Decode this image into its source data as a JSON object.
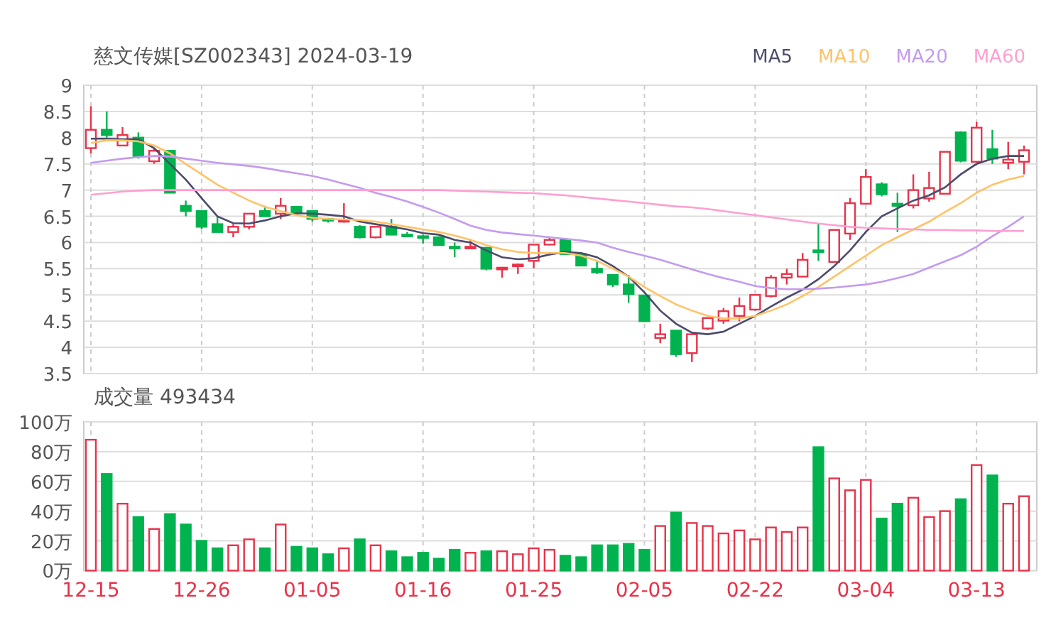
{
  "header": {
    "title": "慈文传媒[SZ002343] 2024-03-19"
  },
  "price_chart": {
    "chart_data": {
      "type": "candlestick",
      "ylim": [
        3.5,
        9
      ],
      "yticks": [
        3.5,
        4,
        4.5,
        5,
        5.5,
        6,
        6.5,
        7,
        7.5,
        8,
        8.5,
        9
      ],
      "grid": true,
      "series": [
        {
          "name": "MA5",
          "type": "line",
          "color": "#4b4b6b",
          "values": [
            7.98,
            7.98,
            7.97,
            7.97,
            7.8,
            7.5,
            7.2,
            6.85,
            6.5,
            6.37,
            6.36,
            6.42,
            6.5,
            6.56,
            6.55,
            6.53,
            6.5,
            6.4,
            6.35,
            6.3,
            6.25,
            6.18,
            6.15,
            6.05,
            6.0,
            5.85,
            5.72,
            5.68,
            5.7,
            5.77,
            5.82,
            5.8,
            5.72,
            5.55,
            5.35,
            5.05,
            4.7,
            4.45,
            4.28,
            4.25,
            4.3,
            4.45,
            4.6,
            4.78,
            4.95,
            5.1,
            5.3,
            5.55,
            5.85,
            6.2,
            6.5,
            6.65,
            6.8,
            6.9,
            7.05,
            7.3,
            7.5,
            7.6,
            7.65,
            7.65
          ]
        },
        {
          "name": "MA10",
          "type": "line",
          "color": "#ffc266",
          "values": [
            7.9,
            7.95,
            7.95,
            7.93,
            7.85,
            7.7,
            7.5,
            7.3,
            7.1,
            6.95,
            6.8,
            6.68,
            6.6,
            6.52,
            6.47,
            6.45,
            6.44,
            6.43,
            6.4,
            6.35,
            6.3,
            6.25,
            6.2,
            6.13,
            6.05,
            5.95,
            5.87,
            5.82,
            5.8,
            5.8,
            5.8,
            5.75,
            5.65,
            5.5,
            5.35,
            5.15,
            4.98,
            4.82,
            4.7,
            4.6,
            4.55,
            4.55,
            4.6,
            4.7,
            4.82,
            4.98,
            5.15,
            5.35,
            5.55,
            5.75,
            5.95,
            6.1,
            6.25,
            6.4,
            6.58,
            6.75,
            6.95,
            7.1,
            7.2,
            7.27
          ]
        },
        {
          "name": "MA20",
          "type": "line",
          "color": "#c39bef",
          "values": [
            7.52,
            7.56,
            7.6,
            7.63,
            7.65,
            7.64,
            7.6,
            7.56,
            7.52,
            7.49,
            7.46,
            7.42,
            7.37,
            7.32,
            7.27,
            7.2,
            7.12,
            7.04,
            6.95,
            6.87,
            6.78,
            6.68,
            6.57,
            6.45,
            6.32,
            6.24,
            6.19,
            6.16,
            6.13,
            6.1,
            6.07,
            6.04,
            6.0,
            5.9,
            5.82,
            5.75,
            5.67,
            5.58,
            5.49,
            5.4,
            5.32,
            5.25,
            5.17,
            5.13,
            5.11,
            5.11,
            5.12,
            5.14,
            5.17,
            5.2,
            5.25,
            5.32,
            5.4,
            5.52,
            5.64,
            5.76,
            5.92,
            6.12,
            6.3,
            6.5
          ]
        },
        {
          "name": "MA60",
          "type": "line",
          "color": "#ff9fd0",
          "values": [
            6.91,
            6.94,
            6.97,
            6.99,
            7.0,
            7.0,
            7.0,
            7.0,
            7.0,
            7.0,
            7.0,
            7.0,
            7.0,
            7.0,
            7.0,
            7.0,
            7.0,
            7.0,
            7.0,
            7.0,
            7.0,
            7.0,
            7.0,
            6.99,
            6.98,
            6.97,
            6.96,
            6.95,
            6.94,
            6.92,
            6.9,
            6.87,
            6.84,
            6.81,
            6.78,
            6.75,
            6.72,
            6.69,
            6.67,
            6.64,
            6.6,
            6.56,
            6.52,
            6.48,
            6.44,
            6.4,
            6.36,
            6.33,
            6.3,
            6.28,
            6.27,
            6.26,
            6.25,
            6.24,
            6.24,
            6.23,
            6.23,
            6.22,
            6.22,
            6.22
          ]
        }
      ],
      "ohlc": [
        [
          7.8,
          8.6,
          7.7,
          8.15
        ],
        [
          8.15,
          8.5,
          8.0,
          8.05
        ],
        [
          7.85,
          8.2,
          7.85,
          8.05
        ],
        [
          8.0,
          8.1,
          7.6,
          7.65
        ],
        [
          7.55,
          7.8,
          7.5,
          7.75
        ],
        [
          7.75,
          7.75,
          6.95,
          6.95
        ],
        [
          6.7,
          6.8,
          6.5,
          6.6
        ],
        [
          6.6,
          6.6,
          6.25,
          6.3
        ],
        [
          6.35,
          6.5,
          6.2,
          6.2
        ],
        [
          6.2,
          6.35,
          6.1,
          6.3
        ],
        [
          6.3,
          6.55,
          6.25,
          6.55
        ],
        [
          6.6,
          6.7,
          6.5,
          6.5
        ],
        [
          6.55,
          6.85,
          6.45,
          6.7
        ],
        [
          6.68,
          6.7,
          6.55,
          6.58
        ],
        [
          6.6,
          6.62,
          6.4,
          6.45
        ],
        [
          6.45,
          6.47,
          6.38,
          6.42
        ],
        [
          6.42,
          6.75,
          6.38,
          6.43
        ],
        [
          6.3,
          6.33,
          6.08,
          6.1
        ],
        [
          6.1,
          6.3,
          6.08,
          6.3
        ],
        [
          6.3,
          6.45,
          6.15,
          6.15
        ],
        [
          6.15,
          6.2,
          6.1,
          6.12
        ],
        [
          6.12,
          6.15,
          5.98,
          6.1
        ],
        [
          6.1,
          6.12,
          5.95,
          5.95
        ],
        [
          5.92,
          6.0,
          5.72,
          5.9
        ],
        [
          5.9,
          6.05,
          5.88,
          5.92
        ],
        [
          5.9,
          5.9,
          5.47,
          5.5
        ],
        [
          5.5,
          5.52,
          5.33,
          5.52
        ],
        [
          5.55,
          5.6,
          5.4,
          5.58
        ],
        [
          5.65,
          5.96,
          5.51,
          5.96
        ],
        [
          5.96,
          6.1,
          5.95,
          6.05
        ],
        [
          6.05,
          6.05,
          5.78,
          5.78
        ],
        [
          5.78,
          5.78,
          5.56,
          5.56
        ],
        [
          5.5,
          5.65,
          5.4,
          5.43
        ],
        [
          5.38,
          5.4,
          5.15,
          5.2
        ],
        [
          5.2,
          5.38,
          4.85,
          5.02
        ],
        [
          4.99,
          4.99,
          4.5,
          4.5
        ],
        [
          4.18,
          4.45,
          4.08,
          4.25
        ],
        [
          4.32,
          4.32,
          3.82,
          3.87
        ],
        [
          3.89,
          4.25,
          3.72,
          4.25
        ],
        [
          4.36,
          4.56,
          4.33,
          4.56
        ],
        [
          4.51,
          4.75,
          4.45,
          4.69
        ],
        [
          4.6,
          4.95,
          4.5,
          4.79
        ],
        [
          4.72,
          5.0,
          4.7,
          5.0
        ],
        [
          4.98,
          5.38,
          4.95,
          5.33
        ],
        [
          5.33,
          5.5,
          5.2,
          5.4
        ],
        [
          5.35,
          5.8,
          5.35,
          5.67
        ],
        [
          5.85,
          6.35,
          5.65,
          5.83
        ],
        [
          5.63,
          6.24,
          5.63,
          6.24
        ],
        [
          6.17,
          6.85,
          6.05,
          6.75
        ],
        [
          6.74,
          7.4,
          6.74,
          7.25
        ],
        [
          7.11,
          7.15,
          6.88,
          6.92
        ],
        [
          6.74,
          6.95,
          6.2,
          6.7
        ],
        [
          6.71,
          7.3,
          6.65,
          7.0
        ],
        [
          6.84,
          7.35,
          6.78,
          7.04
        ],
        [
          6.93,
          7.73,
          6.93,
          7.73
        ],
        [
          8.1,
          8.12,
          7.53,
          7.56
        ],
        [
          7.54,
          8.3,
          7.54,
          8.19
        ],
        [
          7.78,
          8.15,
          7.5,
          7.6
        ],
        [
          7.52,
          7.92,
          7.4,
          7.58
        ],
        [
          7.54,
          7.85,
          7.3,
          7.76
        ]
      ]
    }
  },
  "volume_chart": {
    "title": "成交量 493434",
    "x_axis_labels": [
      "12-15",
      "12-26",
      "01-05",
      "01-16",
      "01-25",
      "02-05",
      "02-22",
      "03-04",
      "03-13"
    ],
    "chart_data": {
      "type": "bar",
      "ylim": [
        0,
        100
      ],
      "grid": true,
      "yticks": [
        {
          "value": 0,
          "label": "0万"
        },
        {
          "value": 20,
          "label": "20万"
        },
        {
          "value": 40,
          "label": "40万"
        },
        {
          "value": 60,
          "label": "60万"
        },
        {
          "value": 80,
          "label": "80万"
        },
        {
          "value": 100,
          "label": "100万"
        }
      ],
      "values": [
        88,
        65,
        45,
        36,
        28,
        38,
        31,
        20,
        15,
        17,
        21,
        15,
        31,
        16,
        15,
        11,
        15,
        21,
        17,
        13,
        9,
        12,
        8,
        14,
        12,
        13,
        13,
        11,
        15,
        14,
        10,
        9,
        17,
        17,
        18,
        14,
        30,
        39,
        32,
        30,
        25,
        27,
        21,
        29,
        26,
        29,
        83,
        62,
        54,
        61,
        35,
        45,
        49,
        36,
        40,
        48,
        71,
        64,
        45,
        50
      ]
    }
  }
}
